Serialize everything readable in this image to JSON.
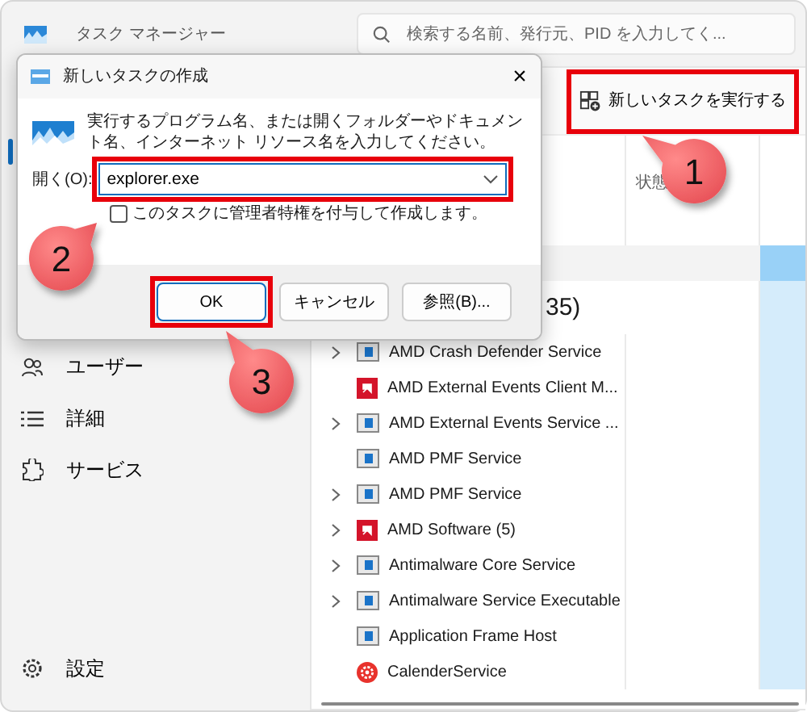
{
  "window": {
    "title": "タスク マネージャー"
  },
  "search": {
    "placeholder": "検索する名前、発行元、PID を入力してく..."
  },
  "toolbar": {
    "new_task_button": {
      "label": "新しいタスクを実行する",
      "highlighted": true
    }
  },
  "table": {
    "columns": [
      "状態"
    ],
    "group_heading": "35)",
    "rows": [
      {
        "name": "AMD Crash Defender Service",
        "expandable": true,
        "kind": "window"
      },
      {
        "name": "AMD External Events Client M...",
        "expandable": false,
        "kind": "amd"
      },
      {
        "name": "AMD External Events Service ...",
        "expandable": true,
        "kind": "window"
      },
      {
        "name": "AMD PMF Service",
        "expandable": false,
        "kind": "window"
      },
      {
        "name": "AMD PMF Service",
        "expandable": true,
        "kind": "window"
      },
      {
        "name": "AMD Software (5)",
        "expandable": true,
        "kind": "amd"
      },
      {
        "name": "Antimalware Core Service",
        "expandable": true,
        "kind": "window"
      },
      {
        "name": "Antimalware Service Executable",
        "expandable": true,
        "kind": "window"
      },
      {
        "name": "Application Frame Host",
        "expandable": false,
        "kind": "window"
      },
      {
        "name": "CalenderService",
        "expandable": false,
        "kind": "gear"
      }
    ]
  },
  "sidebar": {
    "items": [
      {
        "label": "ユーザー",
        "kind": "users"
      },
      {
        "label": "詳細",
        "kind": "list"
      },
      {
        "label": "サービス",
        "kind": "puzzle"
      }
    ],
    "settings": {
      "label": "設定"
    }
  },
  "dialog": {
    "title": "新しいタスクの作成",
    "close": "×",
    "description": "実行するプログラム名、または開くフォルダーやドキュメント名、インターネット リソース名を入力してください。",
    "open_label": "開く(O):",
    "open_value": "explorer.exe",
    "open_highlighted": true,
    "admin_checkbox": {
      "label": "このタスクに管理者特権を付与して作成します。",
      "checked": false
    },
    "buttons": [
      {
        "label": "OK",
        "highlighted": true,
        "default": true
      },
      {
        "label": "キャンセル",
        "highlighted": false,
        "default": false
      },
      {
        "label": "参照(B)...",
        "highlighted": false,
        "default": false
      }
    ]
  },
  "callouts": [
    {
      "number": "1"
    },
    {
      "number": "2"
    },
    {
      "number": "3"
    }
  ]
}
